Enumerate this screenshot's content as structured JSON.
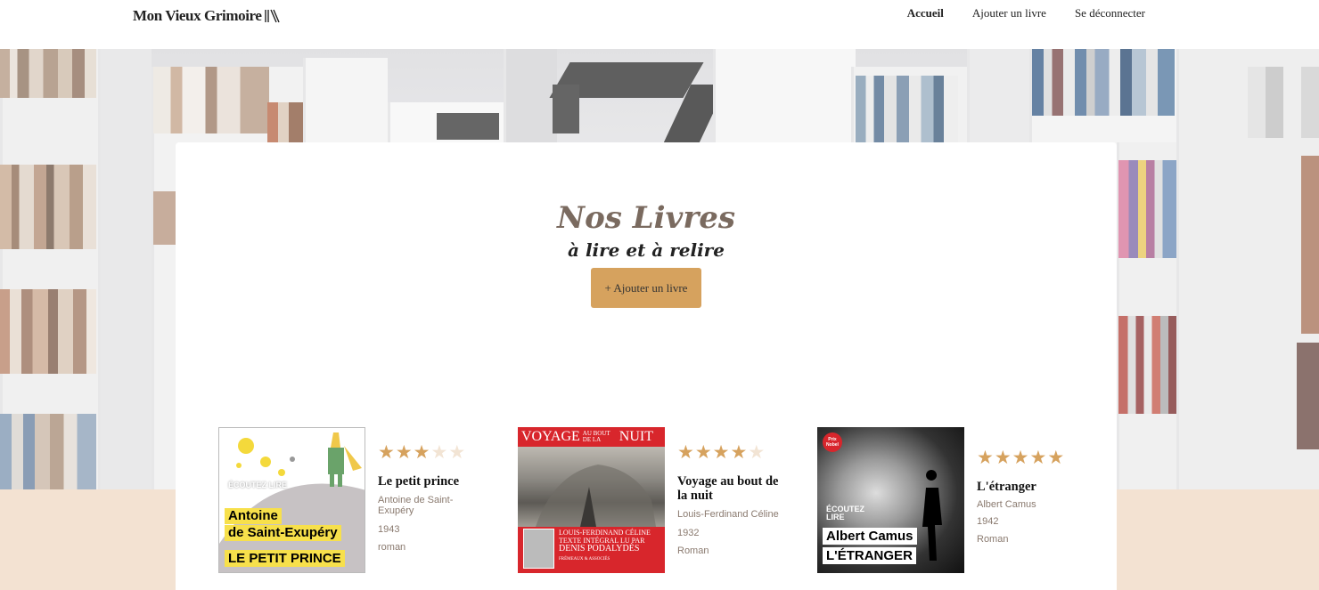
{
  "header": {
    "logo": "Mon Vieux Grimoire",
    "nav": [
      {
        "label": "Accueil",
        "active": true
      },
      {
        "label": "Ajouter un livre",
        "active": false
      },
      {
        "label": "Se déconnecter",
        "active": false
      }
    ]
  },
  "main": {
    "title": "Nos Livres",
    "subtitle": "à lire et à relire",
    "add_button": "+ Ajouter un livre"
  },
  "books": [
    {
      "title": "Le petit prince",
      "author": "Antoine de Saint-Exupéry",
      "year": "1943",
      "genre": "roman",
      "rating": 3,
      "cover": {
        "label_top": "Antoine",
        "label_mid": "de Saint-Exupéry",
        "label_bottom": "LE PETIT PRINCE",
        "badge": "ÉCOUTEZ LIRE"
      }
    },
    {
      "title": "Voyage au bout de la nuit",
      "author": "Louis-Ferdinand Céline",
      "year": "1932",
      "genre": "Roman",
      "rating": 4,
      "cover": {
        "banner_a": "VOYAGE",
        "banner_b": "AU BOUT DE LA",
        "banner_c": "NUIT",
        "line1": "LOUIS-FERDINAND CÉLINE",
        "line2": "TEXTE INTÉGRAL LU PAR",
        "line3": "DENIS PODALYDÈS",
        "publisher": "FRÉMEAUX & ASSOCIÉS"
      }
    },
    {
      "title": "L'étranger",
      "author": "Albert Camus",
      "year": "1942",
      "genre": "Roman",
      "rating": 5,
      "cover": {
        "badge": "ÉCOUTEZ LIRE",
        "prize": "Prix Nobel",
        "label_author": "Albert Camus",
        "label_title": "L'ÉTRANGER"
      }
    }
  ],
  "colors": {
    "accent": "#d6a25e",
    "title": "#7a6a5f",
    "star_empty": "#f2e4d4",
    "band": "#f3e2d2"
  }
}
